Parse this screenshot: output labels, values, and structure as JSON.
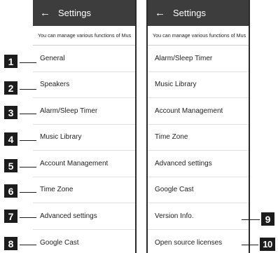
{
  "left_screen": {
    "title": "Settings",
    "back_icon": "arrow-left-icon",
    "description": "You can manage various functions of Mus",
    "items": [
      "General",
      "Speakers",
      "Alarm/Sleep Timer",
      "Music Library",
      "Account Management",
      "Time Zone",
      "Advanced settings",
      "Google Cast"
    ]
  },
  "right_screen": {
    "title": "Settings",
    "back_icon": "arrow-left-icon",
    "description": "You can manage various functions of Mus",
    "items": [
      "Alarm/Sleep Timer",
      "Music Library",
      "Account Management",
      "Time Zone",
      "Advanced settings",
      "Google Cast",
      "Version Info.",
      "Open source licenses"
    ]
  },
  "callouts": {
    "left": [
      "1",
      "2",
      "3",
      "4",
      "5",
      "6",
      "7",
      "8"
    ],
    "right": [
      "9",
      "10"
    ]
  },
  "colors": {
    "appbar": "#3d3d3d",
    "badge": "#1c1c1c"
  }
}
